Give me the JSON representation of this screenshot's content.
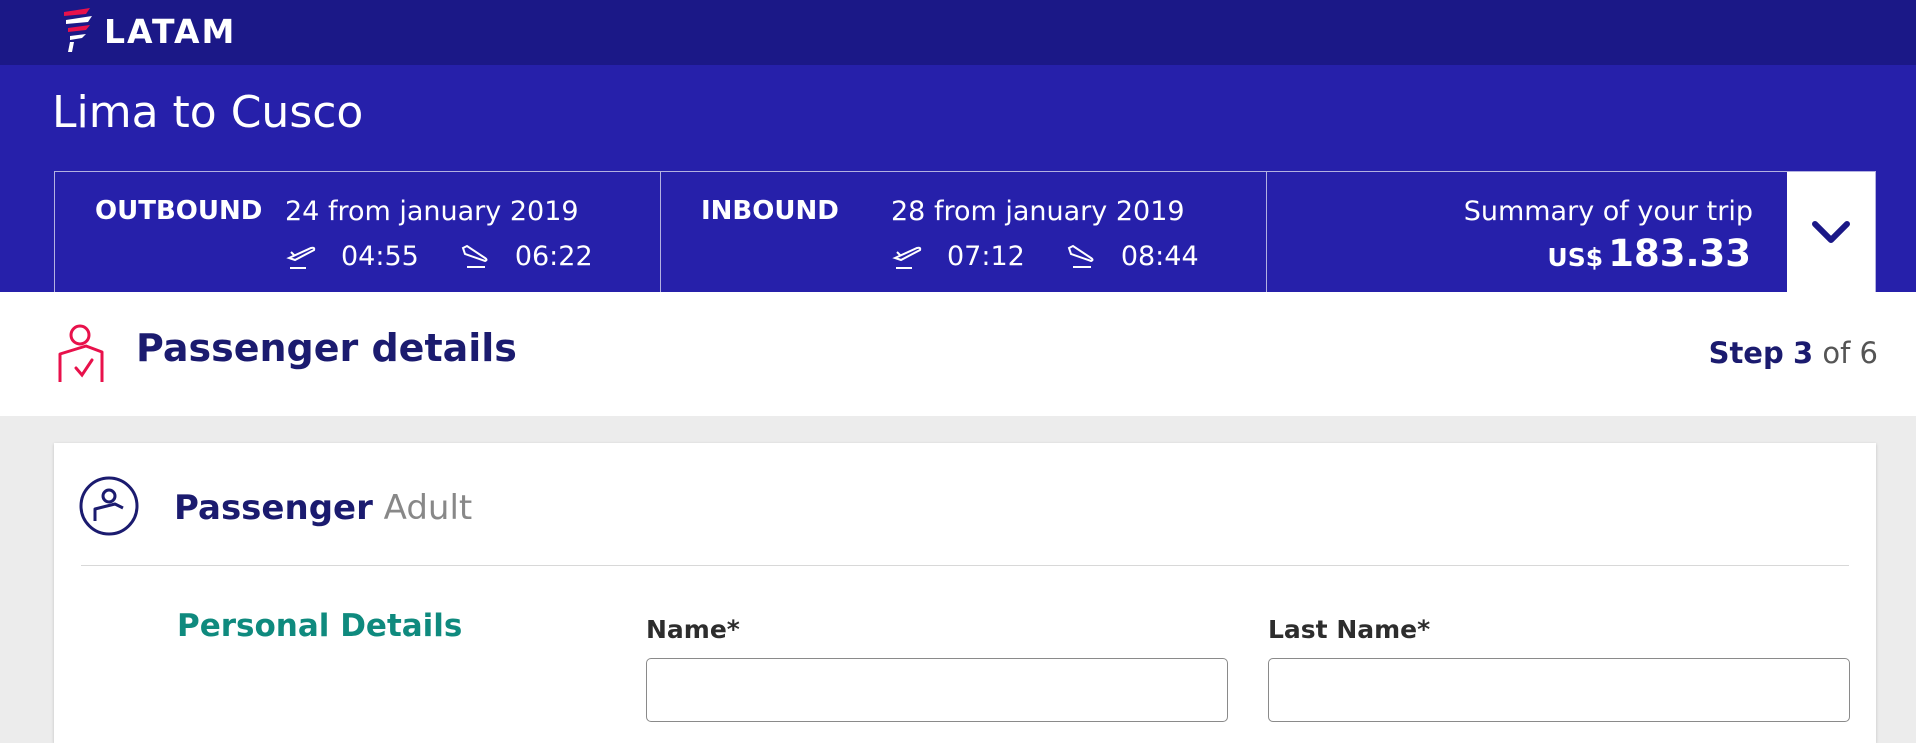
{
  "brand": {
    "name": "LATAM",
    "colors": {
      "header": "#1b1887",
      "band": "#2620aa",
      "accent": "#e8114b",
      "teal": "#0f8a7e"
    }
  },
  "trip": {
    "route": "Lima to Cusco",
    "outbound": {
      "label": "OUTBOUND",
      "date": "24 from january 2019",
      "depart": "04:55",
      "arrive": "06:22"
    },
    "inbound": {
      "label": "INBOUND",
      "date": "28 from january 2019",
      "depart": "07:12",
      "arrive": "08:44"
    },
    "summary": {
      "label": "Summary of your trip",
      "currency": "US$",
      "amount": "183.33",
      "toggle_icon": "chevron-down-icon"
    }
  },
  "step": {
    "title": "Passenger details",
    "word": "Step",
    "current": "3",
    "of_text": "of 6"
  },
  "passenger": {
    "title": "Passenger",
    "type": "Adult",
    "section": "Personal Details",
    "fields": {
      "name_label": "Name*",
      "name_value": "",
      "lastname_label": "Last Name*",
      "lastname_value": ""
    }
  }
}
